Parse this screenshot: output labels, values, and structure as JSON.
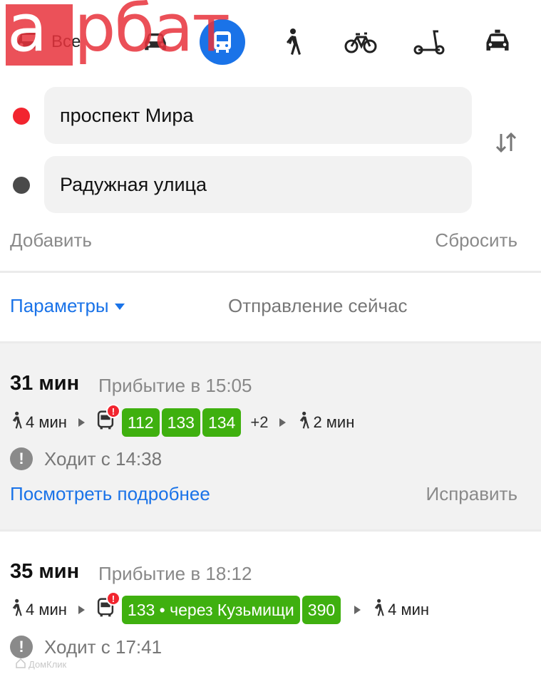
{
  "watermark": {
    "logo_text": "арбат",
    "bottom_text": "ДомКлик"
  },
  "modes": {
    "all_label": "Все",
    "items": [
      {
        "id": "all",
        "icon": "car-icon"
      },
      {
        "id": "car",
        "icon": "car-icon"
      },
      {
        "id": "transit",
        "icon": "bus-icon",
        "selected": true
      },
      {
        "id": "walk",
        "icon": "pedestrian-icon"
      },
      {
        "id": "bike",
        "icon": "bicycle-icon"
      },
      {
        "id": "scooter",
        "icon": "scooter-icon"
      },
      {
        "id": "taxi",
        "icon": "taxi-icon"
      }
    ]
  },
  "route_form": {
    "from_value": "проспект Мира",
    "to_value": "Радужная улица",
    "add_label": "Добавить",
    "reset_label": "Сбросить"
  },
  "options": {
    "params_label": "Параметры",
    "departure_label": "Отправление сейчас"
  },
  "routes": [
    {
      "duration": "31 мин",
      "arrival": "Прибытие в 15:05",
      "walk_start": "4 мин",
      "lines": [
        "112",
        "133",
        "134"
      ],
      "more_lines": "+2",
      "walk_end": "2 мин",
      "schedule": "Ходит с 14:38",
      "details_label": "Посмотреть подробнее",
      "fix_label": "Исправить"
    },
    {
      "duration": "35 мин",
      "arrival": "Прибытие в 18:12",
      "walk_start": "4 мин",
      "lines": [
        "133 • через Кузьмищи",
        "390"
      ],
      "walk_end": "4 мин",
      "schedule": "Ходит с 17:41"
    }
  ],
  "colors": {
    "accent": "#1a73e8",
    "route_badge": "#3fb00f",
    "from_point": "#f2252f",
    "alert": "#f2252f",
    "logo": "#e8323c"
  }
}
